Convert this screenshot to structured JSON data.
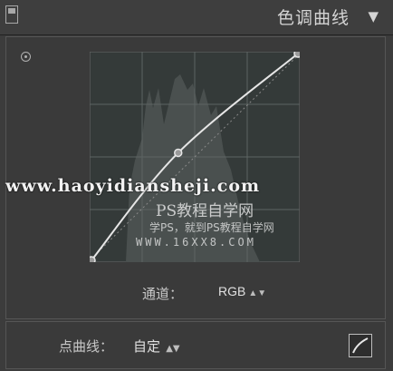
{
  "header": {
    "title": "色调曲线",
    "disclosure_icon": "▼"
  },
  "curve": {
    "channel_label": "通道：",
    "channel_value": "RGB",
    "points": [
      [
        0.0,
        0.0
      ],
      [
        0.42,
        0.52
      ],
      [
        1.0,
        1.0
      ]
    ]
  },
  "point_curve": {
    "label": "点曲线：",
    "value": "自定"
  },
  "watermarks": {
    "url": "www.haoyidiansheji.com",
    "brand": "PS教程自学网",
    "tagline": "学PS，就到PS教程自学网",
    "site": "WWW.16XX8.COM"
  },
  "colors": {
    "panel_bg": "#3c3c3c",
    "curve_line": "#e6e6e6",
    "grid": "#4c5352"
  }
}
